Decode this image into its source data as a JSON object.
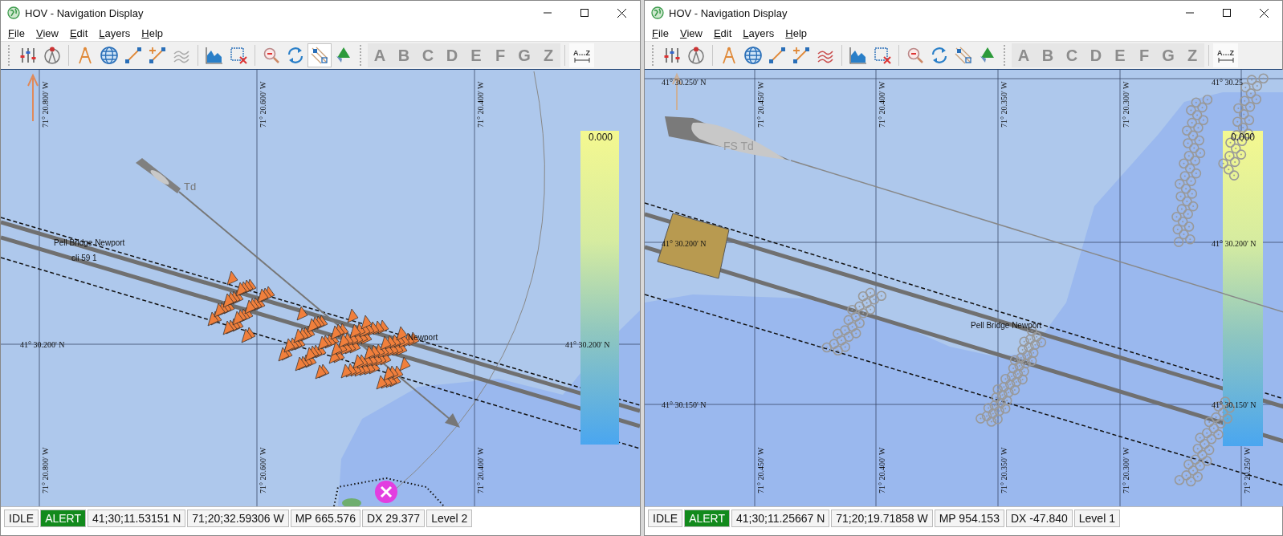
{
  "windows": [
    {
      "title": "HOV - Navigation Display",
      "menu": [
        "File",
        "View",
        "Edit",
        "Layers",
        "Help"
      ],
      "tools": [
        {
          "kind": "sliders",
          "pressed": false
        },
        {
          "kind": "compass",
          "pressed": false
        },
        {
          "kind": "dividers",
          "pressed": false
        },
        {
          "kind": "globe",
          "pressed": false
        },
        {
          "kind": "line",
          "pressed": false
        },
        {
          "kind": "line-plus",
          "pressed": false
        },
        {
          "kind": "waves",
          "pressed": false,
          "on": false
        },
        {
          "kind": "area-chart",
          "pressed": false
        },
        {
          "kind": "box-delete",
          "pressed": false
        },
        {
          "kind": "zoom-out",
          "pressed": false
        },
        {
          "kind": "refresh",
          "pressed": false
        },
        {
          "kind": "route",
          "pressed": true
        },
        {
          "kind": "triangle-marker",
          "pressed": false
        }
      ],
      "letters": [
        "A",
        "B",
        "C",
        "D",
        "E",
        "F",
        "G",
        "Z"
      ],
      "sort_label": "A…Z",
      "map": {
        "kind": "wide",
        "lon_labels_top": [
          "71° 20.800' W",
          "71° 20.600' W",
          "71° 20.400' W"
        ],
        "lon_labels_bottom": [
          "71° 20.800' W",
          "71° 20.600' W",
          "71° 20.400' W"
        ],
        "lat_labels": [
          "41° 30.200' N",
          "41° 30.200' N"
        ],
        "vessel_label": "Td",
        "feature_labels": [
          "Pell Bridge Newport",
          "cli 59 1",
          "Newport"
        ],
        "scale_value": "0.000"
      },
      "status": [
        {
          "text": "IDLE",
          "alert": false
        },
        {
          "text": "ALERT",
          "alert": true
        },
        {
          "text": "41;30;11.53151 N",
          "alert": false
        },
        {
          "text": "71;20;32.59306 W",
          "alert": false
        },
        {
          "text": "MP 665.576",
          "alert": false
        },
        {
          "text": "DX 29.377",
          "alert": false
        },
        {
          "text": "Level 2",
          "alert": false
        }
      ]
    },
    {
      "title": "HOV - Navigation Display",
      "menu": [
        "File",
        "View",
        "Edit",
        "Layers",
        "Help"
      ],
      "tools": [
        {
          "kind": "sliders",
          "pressed": false
        },
        {
          "kind": "compass",
          "pressed": false
        },
        {
          "kind": "dividers",
          "pressed": false
        },
        {
          "kind": "globe",
          "pressed": false
        },
        {
          "kind": "line",
          "pressed": false
        },
        {
          "kind": "line-plus",
          "pressed": false
        },
        {
          "kind": "waves",
          "pressed": false,
          "on": true
        },
        {
          "kind": "area-chart",
          "pressed": false
        },
        {
          "kind": "box-delete",
          "pressed": false
        },
        {
          "kind": "zoom-out",
          "pressed": false
        },
        {
          "kind": "refresh",
          "pressed": false
        },
        {
          "kind": "route",
          "pressed": false
        },
        {
          "kind": "triangle-marker",
          "pressed": false
        }
      ],
      "letters": [
        "A",
        "B",
        "C",
        "D",
        "E",
        "F",
        "G",
        "Z"
      ],
      "sort_label": "A…Z",
      "map": {
        "kind": "close",
        "lon_labels_top": [
          "71° 20.450' W",
          "71° 20.400' W",
          "71° 20.350' W",
          "71° 20.300' W"
        ],
        "lon_labels_bottom": [
          "71° 20.450' W",
          "71° 20.400' W",
          "71° 20.350' W",
          "71° 20.300' W",
          "71° 20.250' W"
        ],
        "lat_labels": [
          "41° 30.250' N",
          "41° 30.25",
          "41° 30.200' N",
          "41° 30.200' N",
          "41° 30.150' N",
          "41° 30.150' N"
        ],
        "vessel_label": "FS Td",
        "feature_labels": [
          "Pell Bridge Newport"
        ],
        "scale_value": "0.000"
      },
      "status": [
        {
          "text": "IDLE",
          "alert": false
        },
        {
          "text": "ALERT",
          "alert": true
        },
        {
          "text": "41;30;11.25667 N",
          "alert": false
        },
        {
          "text": "71;20;19.71858 W",
          "alert": false
        },
        {
          "text": "MP 954.153",
          "alert": false
        },
        {
          "text": "DX -47.840",
          "alert": false
        },
        {
          "text": "Level 1",
          "alert": false
        }
      ]
    }
  ]
}
